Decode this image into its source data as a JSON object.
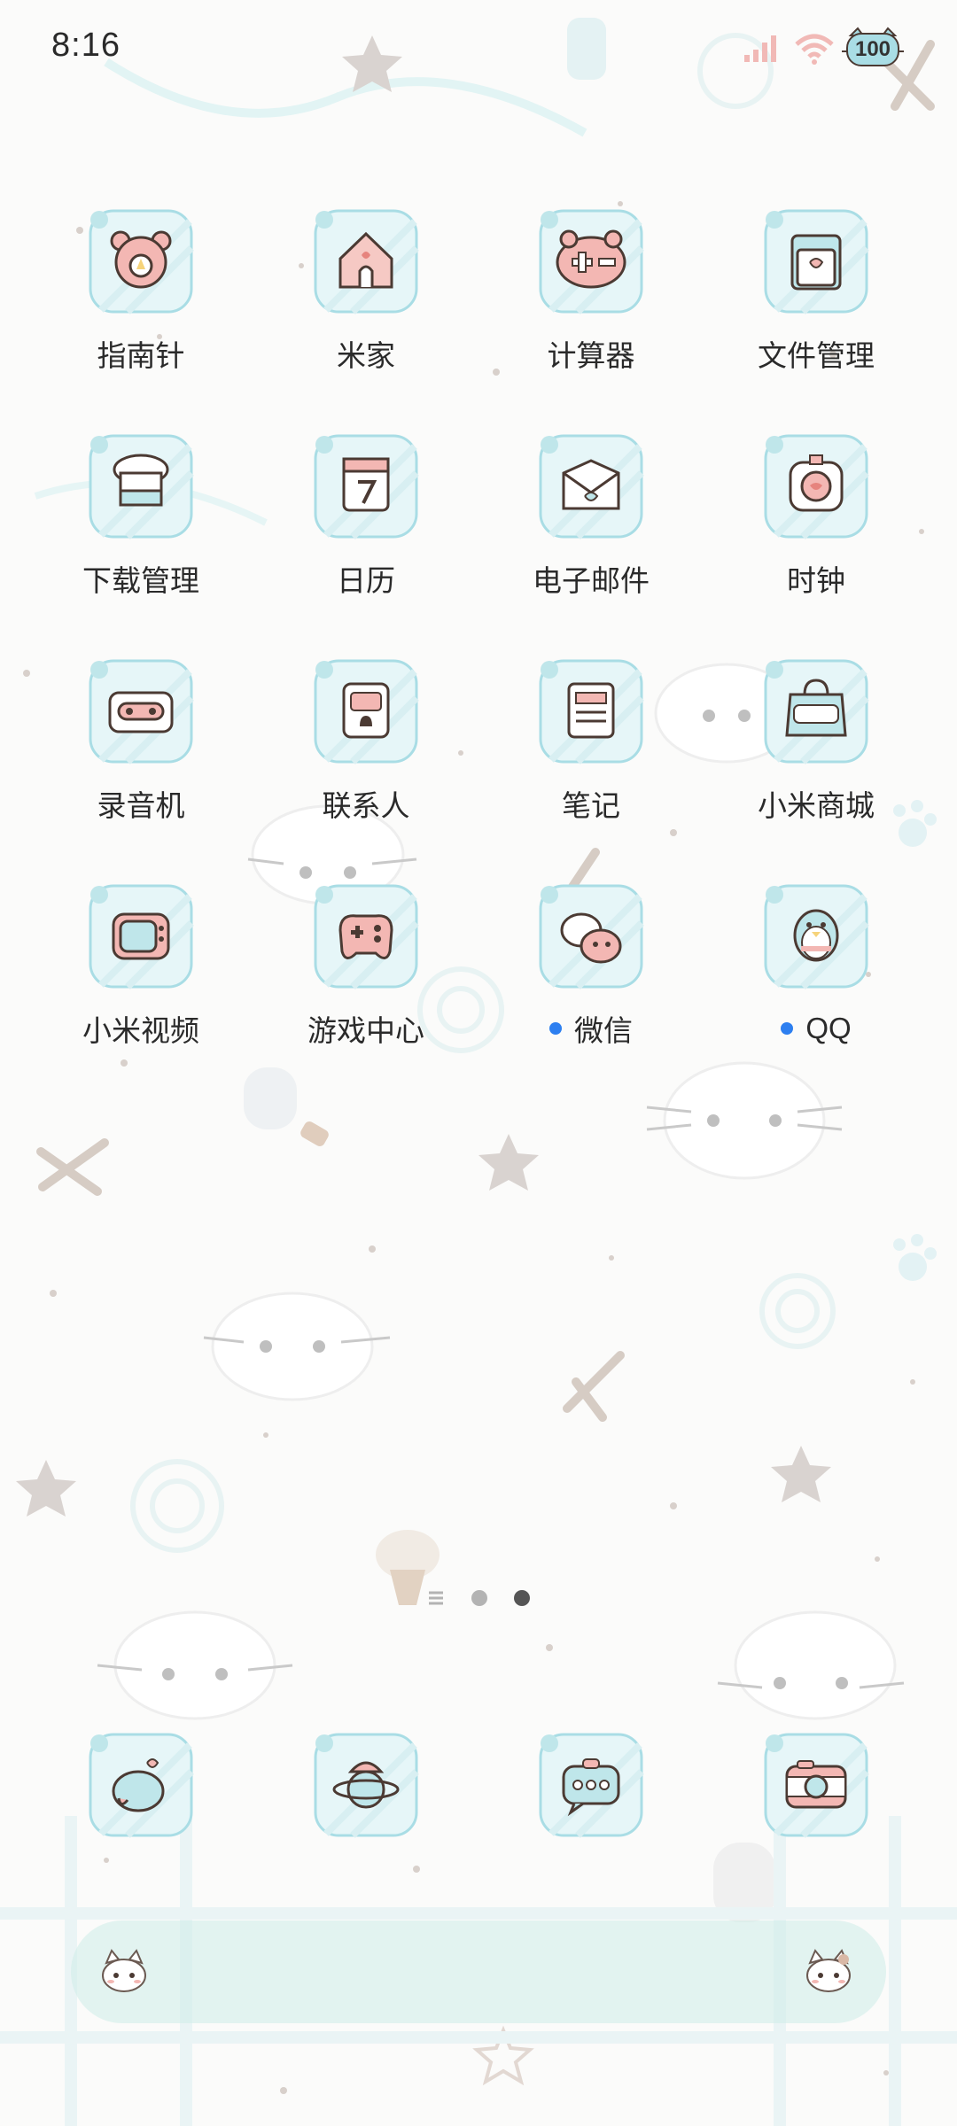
{
  "status_bar": {
    "time": "8:16",
    "battery": "100",
    "signal_icon": "cellular-signal-icon",
    "wifi_icon": "wifi-icon",
    "battery_icon": "cat-battery-icon"
  },
  "home": {
    "rows": [
      [
        {
          "label": "指南针",
          "icon": "compass-bear-icon",
          "notification": false
        },
        {
          "label": "米家",
          "icon": "mijia-house-icon",
          "notification": false
        },
        {
          "label": "计算器",
          "icon": "calculator-frog-icon",
          "notification": false
        },
        {
          "label": "文件管理",
          "icon": "file-folder-icon",
          "notification": false
        }
      ],
      [
        {
          "label": "下载管理",
          "icon": "download-hat-icon",
          "notification": false
        },
        {
          "label": "日历",
          "icon": "calendar-icon",
          "notification": false
        },
        {
          "label": "电子邮件",
          "icon": "email-envelope-icon",
          "notification": false
        },
        {
          "label": "时钟",
          "icon": "clock-icon",
          "notification": false
        }
      ],
      [
        {
          "label": "录音机",
          "icon": "recorder-cassette-icon",
          "notification": false
        },
        {
          "label": "联系人",
          "icon": "contacts-book-icon",
          "notification": false
        },
        {
          "label": "笔记",
          "icon": "notes-icon",
          "notification": false
        },
        {
          "label": "小米商城",
          "icon": "shop-bag-icon",
          "notification": false
        }
      ],
      [
        {
          "label": "小米视频",
          "icon": "video-tv-icon",
          "notification": false
        },
        {
          "label": "游戏中心",
          "icon": "game-controller-icon",
          "notification": false
        },
        {
          "label": "微信",
          "icon": "wechat-bubbles-icon",
          "notification": true
        },
        {
          "label": "QQ",
          "icon": "qq-penguin-icon",
          "notification": true
        }
      ]
    ],
    "page_indicator": {
      "pages": 2,
      "current": 2
    }
  },
  "dock": [
    {
      "icon": "phone-heart-icon"
    },
    {
      "icon": "browser-planet-icon"
    },
    {
      "icon": "messages-chat-icon"
    },
    {
      "icon": "camera-icon"
    }
  ],
  "search_bar": {
    "left_icon": "kitty-icon",
    "right_icon": "kitty-icon"
  },
  "colors": {
    "notification_dot": "#2d7ff0",
    "icon_tile": "#e6f6f8",
    "icon_border": "#a9dde5",
    "icon_pink": "#f3b7b3",
    "icon_outline": "#4b3a33",
    "search_bar": "#cdece8"
  }
}
